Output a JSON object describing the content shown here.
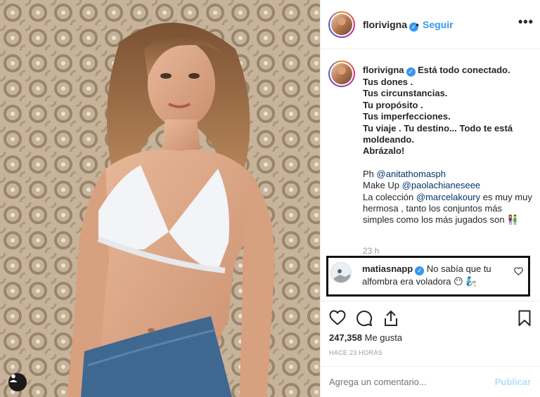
{
  "post": {
    "username": "florivigna",
    "follow_separator": "•",
    "follow_label": "Seguir",
    "more_label": "•••"
  },
  "caption": {
    "username": "florivigna",
    "lines": [
      "Está todo conectado.",
      "Tus dones .",
      "Tus circunstancias.",
      "Tu propósito .",
      "Tus imperfecciones.",
      "Tu viaje . Tu destino... Todo te está",
      "moldeandо.",
      "Abrázalo!"
    ],
    "credits": {
      "ph_label": "Ph",
      "ph_mention": "@anitathomasph",
      "makeup_label": "Make Up",
      "makeup_mention": "@paolachianeseee",
      "collection_prefix": "La colección",
      "collection_mention": "@marcelakoury",
      "collection_text": "es muy muy hermosa , tanto los conjuntos más simples como los más jugados son 👫"
    },
    "time_ago": "23 h"
  },
  "comment": {
    "username": "matiasnapp",
    "text": "No sabía que tu alfombra era voladora 😶 🧞"
  },
  "actions": {
    "likes_count": "247,358",
    "likes_label": "Me gusta",
    "posted_ago": "HACE 23 HORAS"
  },
  "comment_box": {
    "placeholder": "Agrega un comentario...",
    "publish_label": "Publicar"
  },
  "icons": {
    "like": "heart-icon",
    "comment": "comment-bubble-icon",
    "share": "share-icon",
    "save": "bookmark-icon",
    "more": "more-options-icon",
    "user_tags": "user-tag-icon",
    "verified": "verified-badge-icon"
  },
  "colors": {
    "link_blue": "#3897f0",
    "mention": "#003569",
    "muted": "#999999",
    "publish_disabled": "#b2dffc"
  }
}
